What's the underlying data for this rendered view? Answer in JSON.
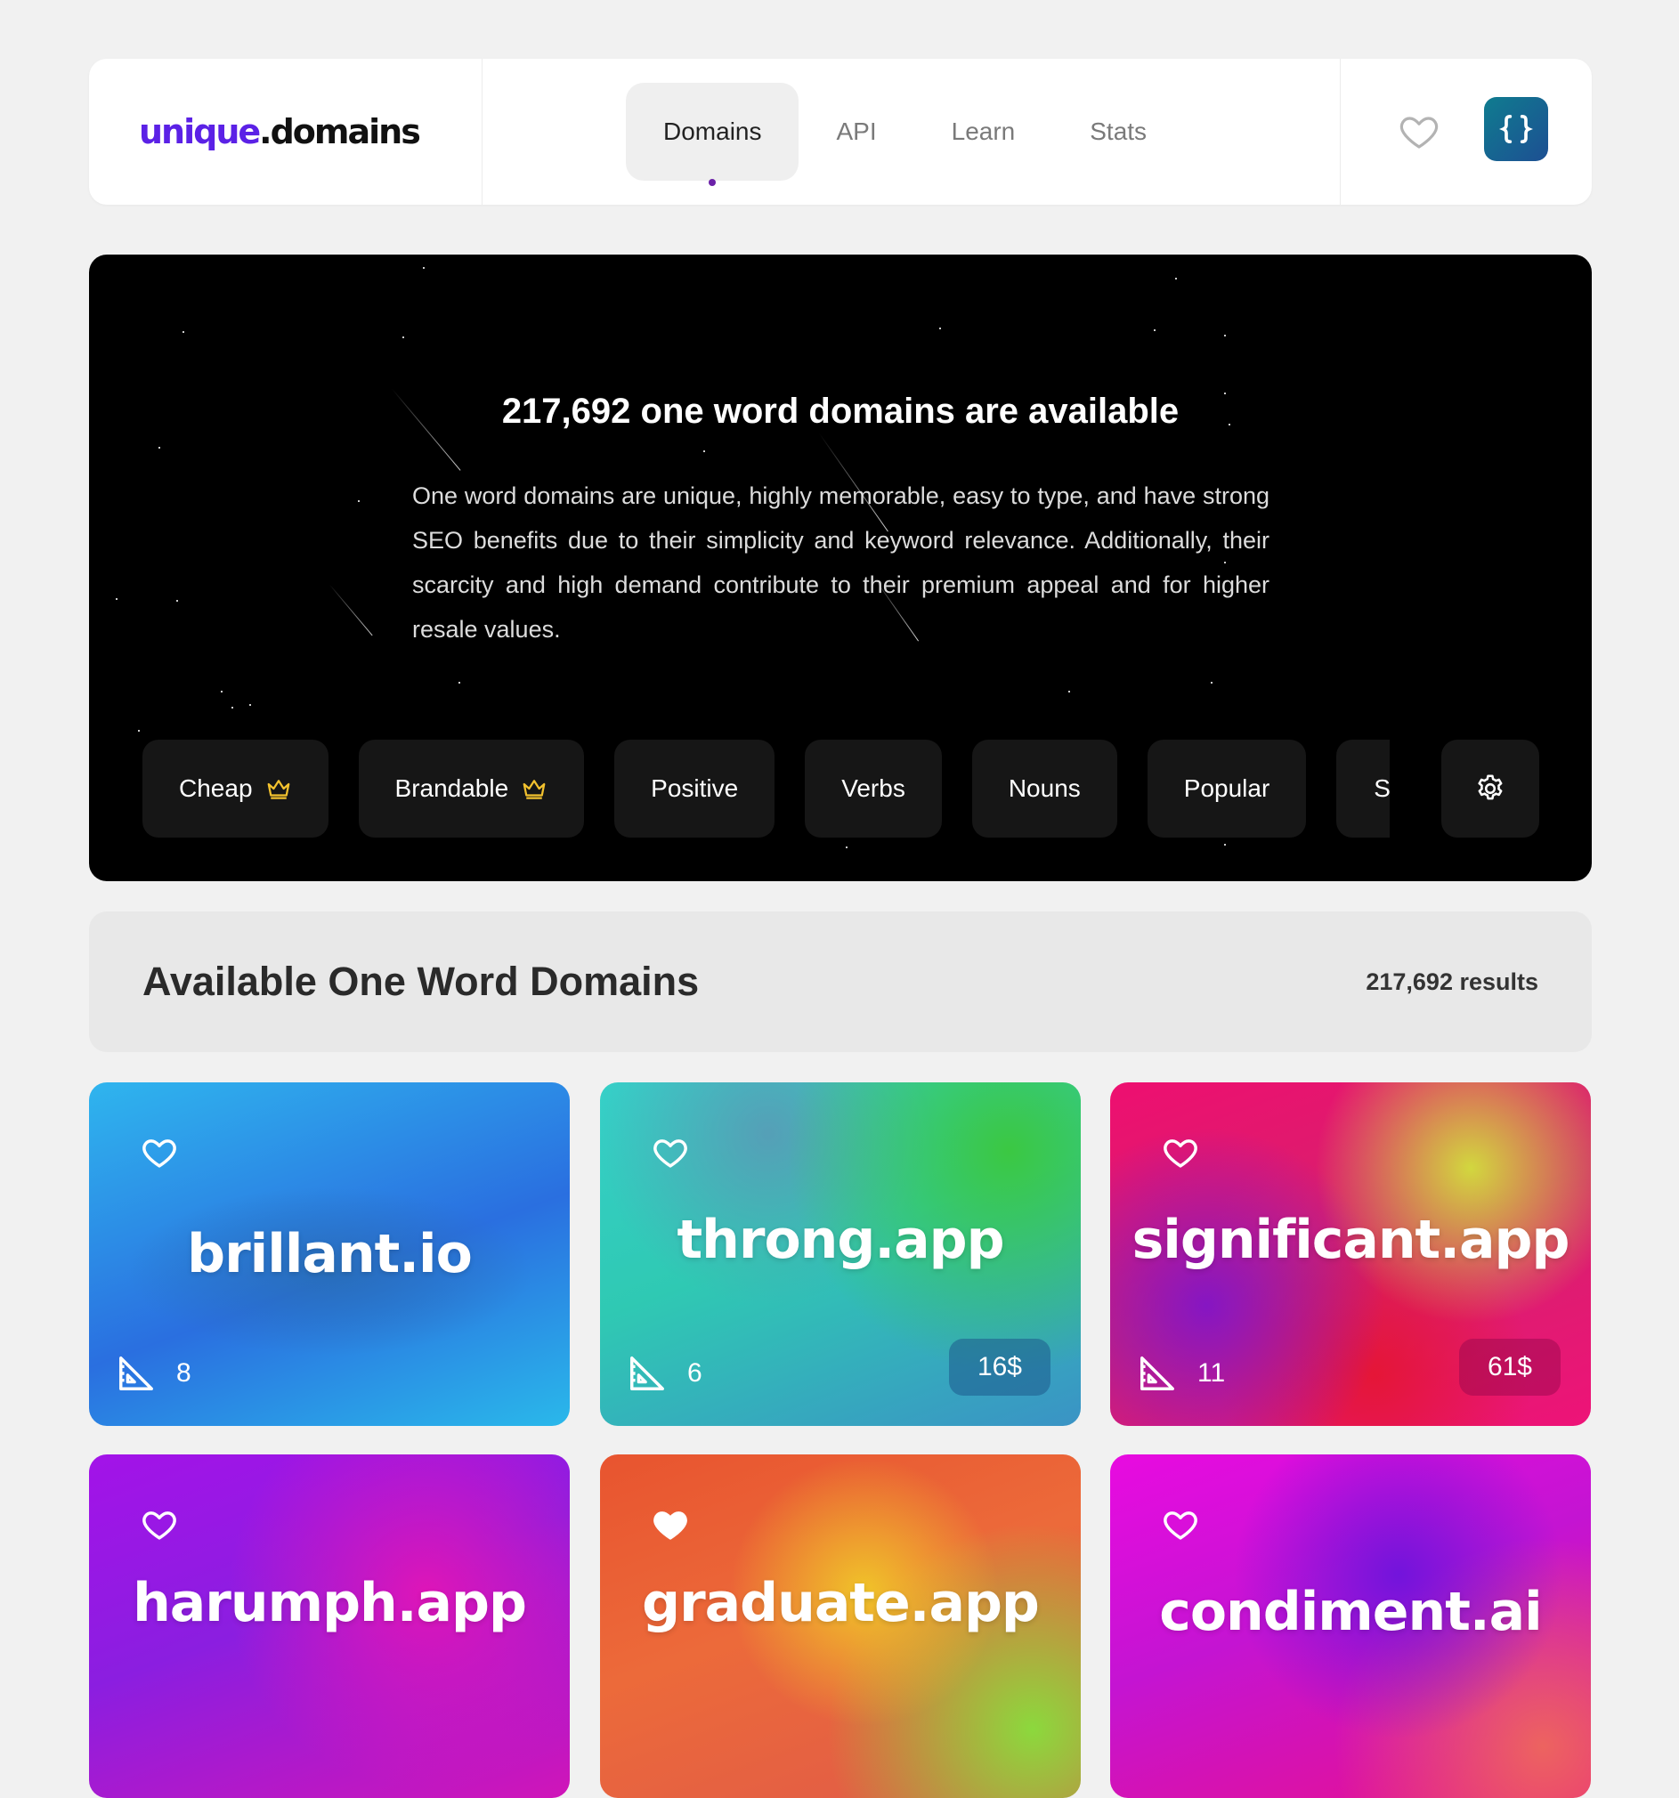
{
  "header": {
    "logo_part1": "unique",
    "logo_part2": ".domains",
    "nav": [
      "Domains",
      "API",
      "Learn",
      "Stats"
    ],
    "active_nav": "Domains",
    "api_icon_glyph": "{}"
  },
  "hero": {
    "title": "217,692 one word domains are available",
    "description": "One word domains are unique, highly memorable, easy to type, and have strong SEO benefits due to their simplicity and keyword relevance. Additionally, their scarcity and high demand contribute to their premium appeal and for higher resale values.",
    "chips": [
      {
        "label": "Cheap",
        "icon": "crown-icon"
      },
      {
        "label": "Brandable",
        "icon": "crown-icon"
      },
      {
        "label": "Positive"
      },
      {
        "label": "Verbs"
      },
      {
        "label": "Nouns"
      },
      {
        "label": "Popular"
      },
      {
        "label": "S"
      }
    ],
    "settings_icon": "gear-icon"
  },
  "results": {
    "title": "Available One Word Domains",
    "count": "217,692 results"
  },
  "cards": [
    {
      "name": "brillant.io",
      "length": "8",
      "price": "",
      "favorited": false
    },
    {
      "name": "throng.app",
      "length": "6",
      "price": "16$",
      "favorited": false
    },
    {
      "name": "significant.app",
      "length": "11",
      "price": "61$",
      "favorited": false
    },
    {
      "name": "harumph.app",
      "favorited": false
    },
    {
      "name": "graduate.app",
      "favorited": true
    },
    {
      "name": "condiment.ai",
      "favorited": false
    }
  ],
  "colors": {
    "brand_purple": "#5b21e6",
    "active_dot": "#6b21a8",
    "crown": "#f2c12e"
  }
}
